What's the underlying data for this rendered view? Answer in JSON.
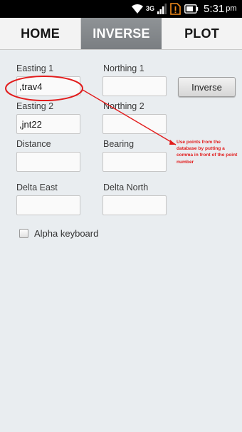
{
  "status_bar": {
    "time": "5:31",
    "ampm": "pm",
    "network": "3G",
    "icons": [
      "wifi-icon",
      "network-type-icon",
      "signal-icon",
      "sim-alert-icon",
      "battery-icon"
    ]
  },
  "tabs": [
    {
      "label": "HOME",
      "active": false
    },
    {
      "label": "INVERSE",
      "active": true
    },
    {
      "label": "PLOT",
      "active": false
    }
  ],
  "form": {
    "easting1": {
      "label": "Easting 1",
      "value": ",trav4"
    },
    "northing1": {
      "label": "Northing 1",
      "value": ""
    },
    "easting2": {
      "label": "Easting 2",
      "value": ",jnt22"
    },
    "northing2": {
      "label": "Northing 2",
      "value": ""
    },
    "distance": {
      "label": "Distance",
      "value": ""
    },
    "bearing": {
      "label": "Bearing",
      "value": ""
    },
    "delta_east": {
      "label": "Delta East",
      "value": ""
    },
    "delta_north": {
      "label": "Delta North",
      "value": ""
    },
    "inverse_button": "Inverse",
    "alpha_keyboard": {
      "label": "Alpha keyboard",
      "checked": false
    }
  },
  "annotation": {
    "text": "Use points from the database by putting a comma in front of the point number",
    "color": "#e21c1c"
  },
  "colors": {
    "active_tab": "#8a8e92",
    "background": "#e9edf0"
  }
}
